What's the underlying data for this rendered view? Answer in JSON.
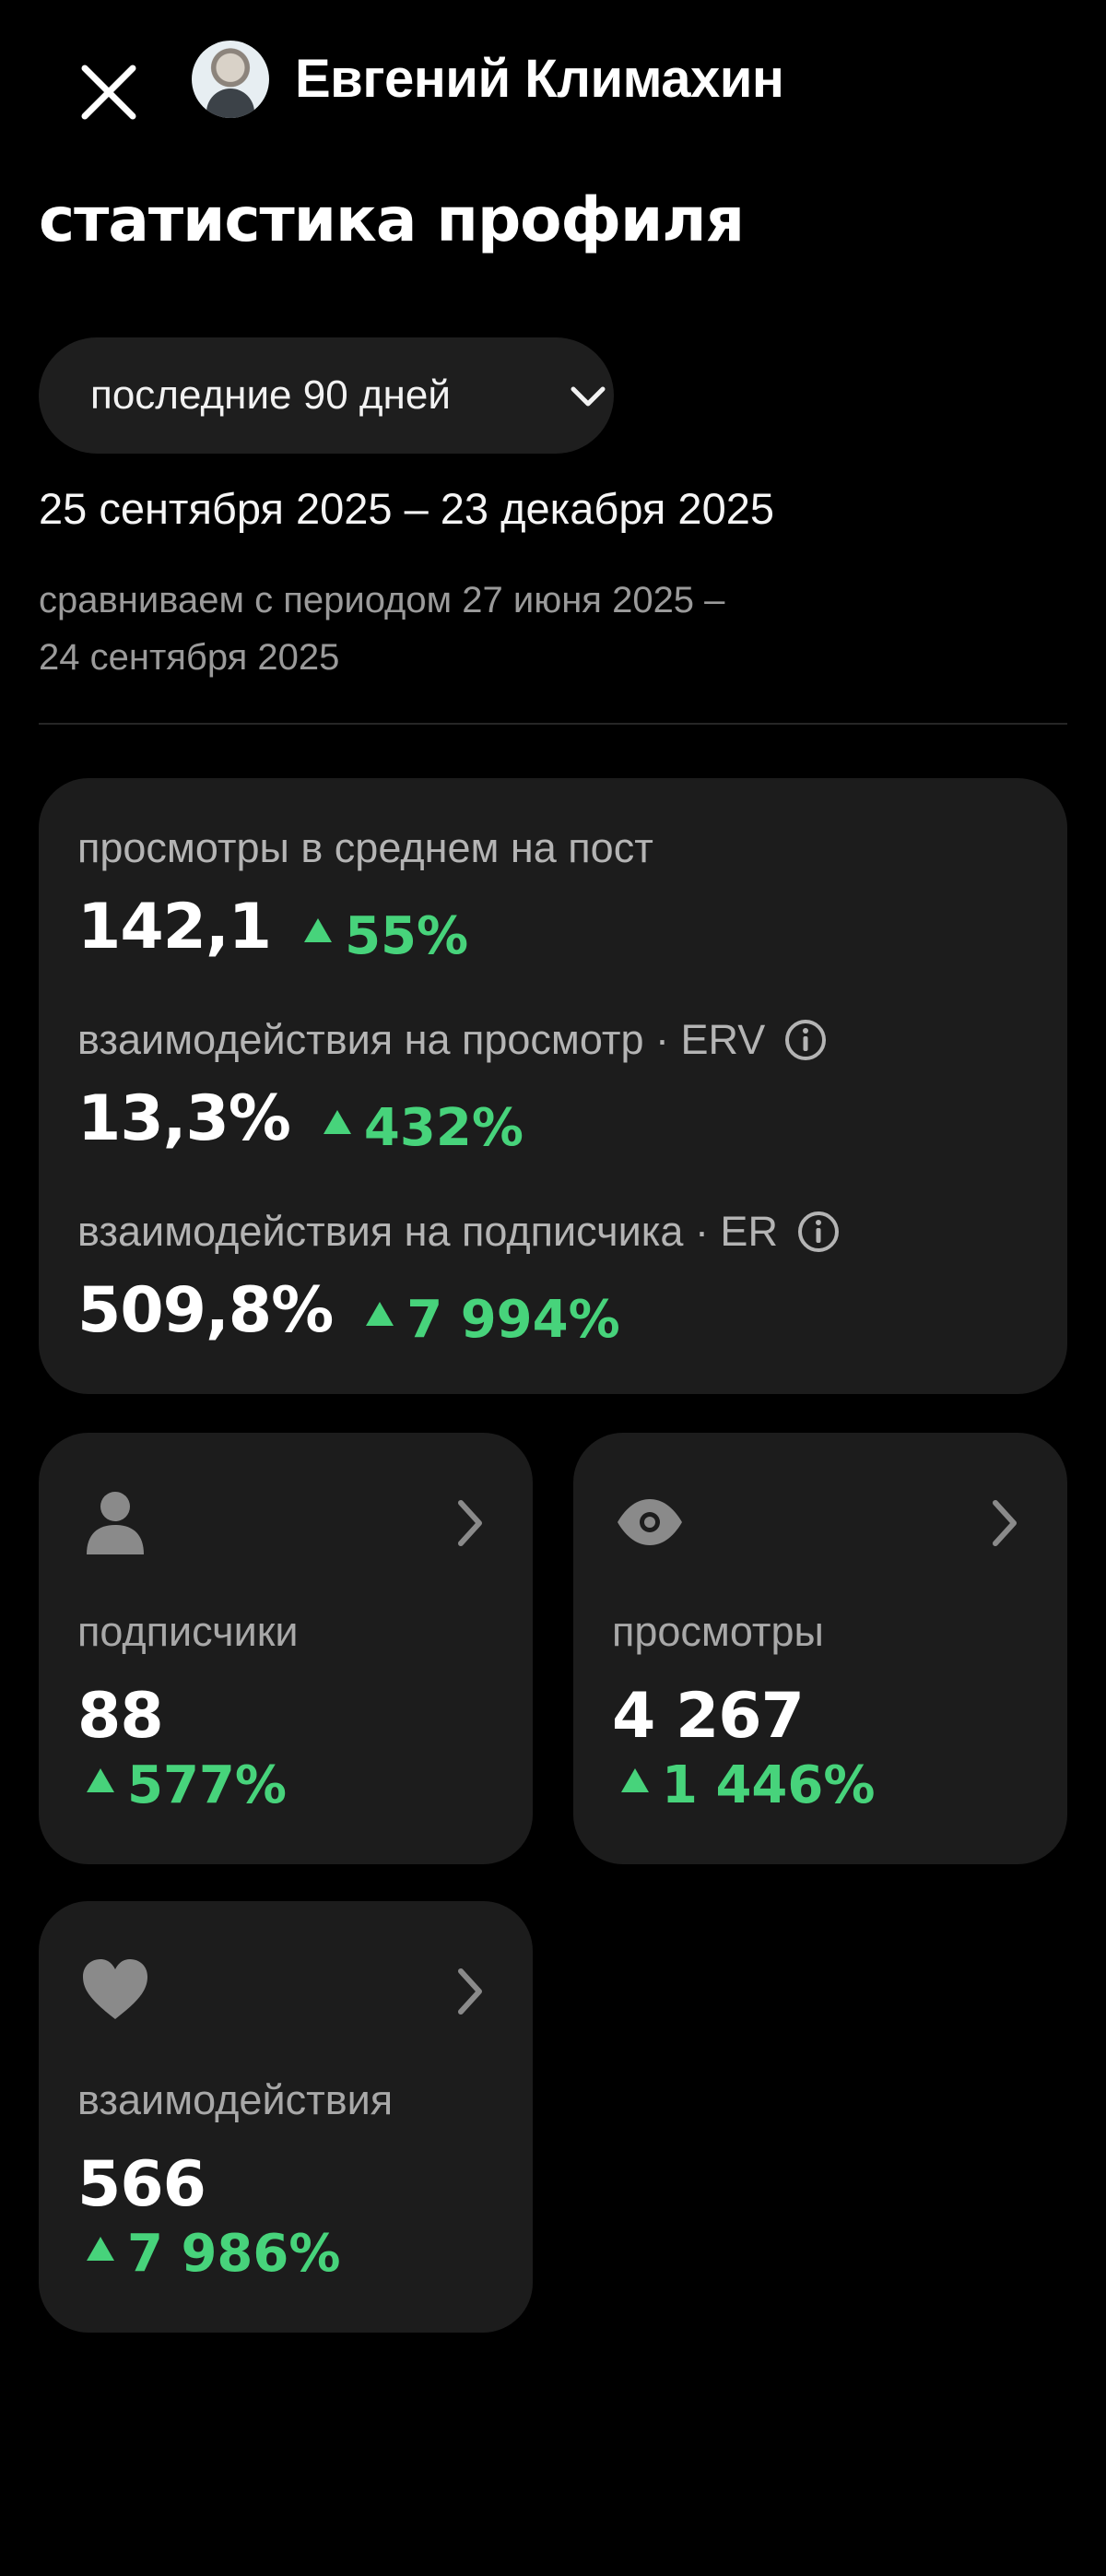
{
  "header": {
    "name": "Евгений Климахин"
  },
  "title": "статистика профиля",
  "period": {
    "selected": "последние 90 дней",
    "range": "25 сентября 2025 – 23 декабря 2025",
    "compare_line1": "сравниваем с периодом 27 июня 2025 –",
    "compare_line2": "24 сентября 2025"
  },
  "summary": [
    {
      "label": "просмотры в среднем на пост",
      "value": "142,1",
      "delta": "55%",
      "info": false
    },
    {
      "label": "взаимодействия на просмотр · ERV",
      "value": "13,3%",
      "delta": "432%",
      "info": true
    },
    {
      "label": "взаимодействия на подписчика · ER",
      "value": "509,8%",
      "delta": "7 994%",
      "info": true
    }
  ],
  "cards": {
    "subscribers": {
      "icon": "person-icon",
      "label": "подписчики",
      "value": "88",
      "delta": "577%"
    },
    "views": {
      "icon": "eye-icon",
      "label": "просмотры",
      "value": "4 267",
      "delta": "1 446%"
    },
    "interactions": {
      "icon": "heart-icon",
      "label": "взаимодействия",
      "value": "566",
      "delta": "7 986%"
    }
  },
  "colors": {
    "background": "#000000",
    "card": "#1c1c1c",
    "positive": "#47d37b",
    "muted_text": "#a8a8a8",
    "icon_gray": "#8a8a8a"
  }
}
